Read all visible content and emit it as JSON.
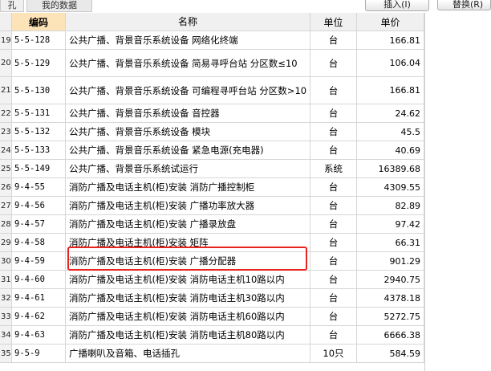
{
  "toolbar": {
    "tab_left": "孔",
    "tab_my_data": "我的数据",
    "insert_button": "插入(I)",
    "replace_button": "替换(R)"
  },
  "table": {
    "headers": {
      "index": "",
      "code": "编码",
      "name": "名称",
      "unit": "单位",
      "price": "单价"
    },
    "rows": [
      {
        "index": "19",
        "code": "5-5-128",
        "name": "公共广播、背景音乐系统设备 网络化终端",
        "unit": "台",
        "price": "166.81"
      },
      {
        "index": "20",
        "code": "5-5-129",
        "name": "公共广播、背景音乐系统设备 简易寻呼台站 分区数≤10",
        "unit": "台",
        "price": "106.04"
      },
      {
        "index": "21",
        "code": "5-5-130",
        "name": "公共广播、背景音乐系统设备 可编程寻呼台站 分区数>10",
        "unit": "台",
        "price": "166.81"
      },
      {
        "index": "22",
        "code": "5-5-131",
        "name": "公共广播、背景音乐系统设备 音控器",
        "unit": "台",
        "price": "24.62"
      },
      {
        "index": "23",
        "code": "5-5-132",
        "name": "公共广播、背景音乐系统设备 模块",
        "unit": "台",
        "price": "45.5"
      },
      {
        "index": "24",
        "code": "5-5-133",
        "name": "公共广播、背景音乐系统设备 紧急电源(充电器)",
        "unit": "台",
        "price": "40.69"
      },
      {
        "index": "25",
        "code": "5-5-149",
        "name": "公共广播、背景音乐系统试运行",
        "unit": "系统",
        "price": "16389.68"
      },
      {
        "index": "26",
        "code": "9-4-55",
        "name": "消防广播及电话主机(柜)安装 消防广播控制柜",
        "unit": "台",
        "price": "4309.55"
      },
      {
        "index": "27",
        "code": "9-4-56",
        "name": "消防广播及电话主机(柜)安装 广播功率放大器",
        "unit": "台",
        "price": "82.89"
      },
      {
        "index": "28",
        "code": "9-4-57",
        "name": "消防广播及电话主机(柜)安装 广播录放盘",
        "unit": "台",
        "price": "97.42"
      },
      {
        "index": "29",
        "code": "9-4-58",
        "name": "消防广播及电话主机(柜)安装 矩阵",
        "unit": "台",
        "price": "66.31"
      },
      {
        "index": "30",
        "code": "9-4-59",
        "name": "消防广播及电话主机(柜)安装 广播分配器",
        "unit": "台",
        "price": "901.29"
      },
      {
        "index": "31",
        "code": "9-4-60",
        "name": "消防广播及电话主机(柜)安装 消防电话主机10路以内",
        "unit": "台",
        "price": "2940.75"
      },
      {
        "index": "32",
        "code": "9-4-61",
        "name": "消防广播及电话主机(柜)安装 消防电话主机30路以内",
        "unit": "台",
        "price": "4378.18"
      },
      {
        "index": "33",
        "code": "9-4-62",
        "name": "消防广播及电话主机(柜)安装 消防电话主机60路以内",
        "unit": "台",
        "price": "5272.75"
      },
      {
        "index": "34",
        "code": "9-4-63",
        "name": "消防广播及电话主机(柜)安装 消防电话主机80路以内",
        "unit": "台",
        "price": "6666.38"
      },
      {
        "index": "35",
        "code": "9-5-9",
        "name": "广播喇叭及音箱、电话插孔",
        "unit": "10只",
        "price": "584.59"
      }
    ]
  },
  "highlight_color": "#e8221c"
}
